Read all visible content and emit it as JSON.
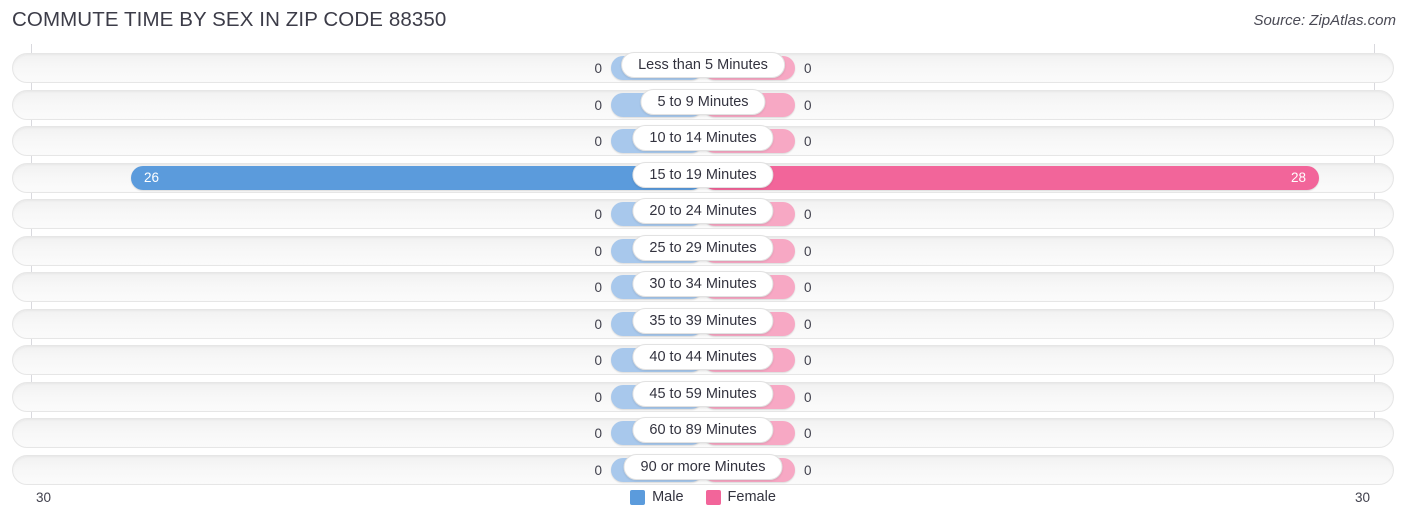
{
  "header": {
    "title": "COMMUTE TIME BY SEX IN ZIP CODE 88350",
    "source": "Source: ZipAtlas.com"
  },
  "legend": {
    "male_label": "Male",
    "female_label": "Female",
    "male_color": "#5b9bdc",
    "female_color": "#f2659a"
  },
  "axis": {
    "left_tick": "30",
    "right_tick": "30",
    "max": 30
  },
  "chart_data": {
    "type": "bar",
    "orientation": "horizontal-diverging",
    "title": "COMMUTE TIME BY SEX IN ZIP CODE 88350",
    "xlabel": "",
    "ylabel": "",
    "xlim": [
      30,
      30
    ],
    "grid": false,
    "legend_position": "bottom-center",
    "categories": [
      "Less than 5 Minutes",
      "5 to 9 Minutes",
      "10 to 14 Minutes",
      "15 to 19 Minutes",
      "20 to 24 Minutes",
      "25 to 29 Minutes",
      "30 to 34 Minutes",
      "35 to 39 Minutes",
      "40 to 44 Minutes",
      "45 to 59 Minutes",
      "60 to 89 Minutes",
      "90 or more Minutes"
    ],
    "series": [
      {
        "name": "Male",
        "values": [
          0,
          0,
          0,
          26,
          0,
          0,
          0,
          0,
          0,
          0,
          0,
          0
        ]
      },
      {
        "name": "Female",
        "values": [
          0,
          0,
          0,
          28,
          0,
          0,
          0,
          0,
          0,
          0,
          0,
          0
        ]
      }
    ]
  },
  "rows": [
    {
      "label": "Less than 5 Minutes",
      "male": "0",
      "female": "0"
    },
    {
      "label": "5 to 9 Minutes",
      "male": "0",
      "female": "0"
    },
    {
      "label": "10 to 14 Minutes",
      "male": "0",
      "female": "0"
    },
    {
      "label": "15 to 19 Minutes",
      "male": "26",
      "female": "28"
    },
    {
      "label": "20 to 24 Minutes",
      "male": "0",
      "female": "0"
    },
    {
      "label": "25 to 29 Minutes",
      "male": "0",
      "female": "0"
    },
    {
      "label": "30 to 34 Minutes",
      "male": "0",
      "female": "0"
    },
    {
      "label": "35 to 39 Minutes",
      "male": "0",
      "female": "0"
    },
    {
      "label": "40 to 44 Minutes",
      "male": "0",
      "female": "0"
    },
    {
      "label": "45 to 59 Minutes",
      "male": "0",
      "female": "0"
    },
    {
      "label": "60 to 89 Minutes",
      "male": "0",
      "female": "0"
    },
    {
      "label": "90 or more Minutes",
      "male": "0",
      "female": "0"
    }
  ]
}
